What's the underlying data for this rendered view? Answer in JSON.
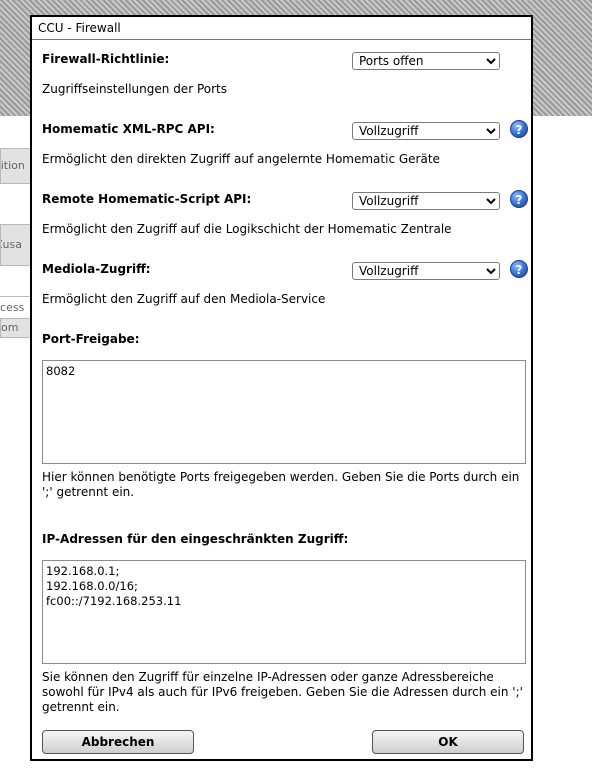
{
  "background": {
    "tabs": [
      "sition",
      "Zusa",
      "ccess",
      "kom"
    ]
  },
  "dialog": {
    "title": "CCU - Firewall",
    "policy": {
      "label": "Firewall-Richtlinie:",
      "selected": "Ports offen",
      "description": "Zugriffseinstellungen der Ports"
    },
    "xmlrpc": {
      "label": "Homematic XML-RPC API:",
      "selected": "Vollzugriff",
      "description": "Ermöglicht den direkten Zugriff auf angelernte Homematic Geräte"
    },
    "script": {
      "label": "Remote Homematic-Script API:",
      "selected": "Vollzugriff",
      "description": "Ermöglicht den Zugriff auf die Logikschicht der Homematic Zentrale"
    },
    "mediola": {
      "label": "Mediola-Zugriff:",
      "selected": "Vollzugriff",
      "description": "Ermöglicht den Zugriff auf den Mediola-Service"
    },
    "help_glyph": "?",
    "ports": {
      "label": "Port-Freigabe:",
      "value": "8082",
      "hint": "Hier können benötigte Ports freigegeben werden. Geben Sie die Ports durch ein ';' getrennt ein."
    },
    "ip": {
      "label": "IP-Adressen für den eingeschränkten Zugriff:",
      "value": "192.168.0.1;\n192.168.0.0/16;\nfc00::/7192.168.253.11",
      "hint": "Sie können den Zugriff für einzelne IP-Adressen oder ganze Adressbereiche sowohl für IPv4 als auch für IPv6 freigeben. Geben Sie die Adressen durch ein ';' getrennt ein."
    },
    "buttons": {
      "cancel": "Abbrechen",
      "ok": "OK"
    }
  }
}
